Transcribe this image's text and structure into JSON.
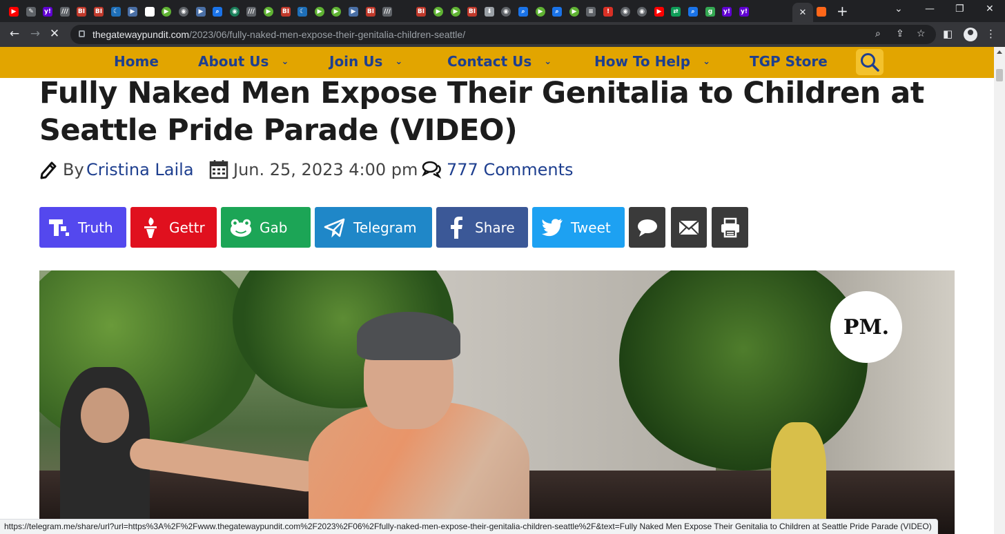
{
  "browser": {
    "tabs": [
      {
        "icon": "youtube-icon",
        "color": "#ff0000",
        "glyph": "▶"
      },
      {
        "icon": "feather-icon",
        "color": "#5f6368",
        "glyph": "✎"
      },
      {
        "icon": "yahoo-icon",
        "color": "#6001d2",
        "glyph": "y!"
      },
      {
        "icon": "ww-icon",
        "color": "#5f6368",
        "glyph": "///"
      },
      {
        "icon": "bi-icon",
        "color": "#c0392b",
        "glyph": "BI"
      },
      {
        "icon": "bi-icon",
        "color": "#c0392b",
        "glyph": "BI"
      },
      {
        "icon": "crescent-icon",
        "color": "#1e6fb8",
        "glyph": "☾"
      },
      {
        "icon": "play-icon",
        "color": "#4a6fa5",
        "glyph": "▶"
      },
      {
        "icon": "grid-icon",
        "color": "#ffffff",
        "glyph": "▦"
      },
      {
        "icon": "rumble-icon",
        "color": "#5fb233",
        "glyph": "▶"
      },
      {
        "icon": "globe-icon",
        "color": "#5f6368",
        "glyph": "◉"
      },
      {
        "icon": "flag-icon",
        "color": "#4a6fa5",
        "glyph": "▶"
      },
      {
        "icon": "search-icon",
        "color": "#1a73e8",
        "glyph": "⌕"
      },
      {
        "icon": "globe-icon",
        "color": "#1a7f5a",
        "glyph": "◉"
      },
      {
        "icon": "ww-icon",
        "color": "#5f6368",
        "glyph": "///"
      },
      {
        "icon": "rumble-icon",
        "color": "#5fb233",
        "glyph": "▶"
      },
      {
        "icon": "bi-icon",
        "color": "#c0392b",
        "glyph": "BI"
      },
      {
        "icon": "crescent-icon",
        "color": "#1e6fb8",
        "glyph": "☾"
      },
      {
        "icon": "rumble-icon",
        "color": "#5fb233",
        "glyph": "▶"
      },
      {
        "icon": "rumble-icon",
        "color": "#5fb233",
        "glyph": "▶"
      },
      {
        "icon": "flag-icon",
        "color": "#4a6fa5",
        "glyph": "▶"
      },
      {
        "icon": "bi-icon",
        "color": "#c0392b",
        "glyph": "BI"
      },
      {
        "icon": "ww-icon",
        "color": "#5f6368",
        "glyph": "///"
      },
      {
        "icon": "blank-icon",
        "color": "#202124",
        "glyph": ""
      },
      {
        "icon": "bi-icon",
        "color": "#c0392b",
        "glyph": "BI"
      },
      {
        "icon": "rumble-icon",
        "color": "#5fb233",
        "glyph": "▶"
      },
      {
        "icon": "rumble-icon",
        "color": "#5fb233",
        "glyph": "▶"
      },
      {
        "icon": "bi-icon",
        "color": "#c0392b",
        "glyph": "BI"
      },
      {
        "icon": "download-icon",
        "color": "#9aa0a6",
        "glyph": "⬇"
      },
      {
        "icon": "globe-icon",
        "color": "#5f6368",
        "glyph": "◉"
      },
      {
        "icon": "search-icon",
        "color": "#1a73e8",
        "glyph": "⌕"
      },
      {
        "icon": "rumble-icon",
        "color": "#5fb233",
        "glyph": "▶"
      },
      {
        "icon": "search-icon",
        "color": "#1a73e8",
        "glyph": "⌕"
      },
      {
        "icon": "rumble-icon",
        "color": "#5fb233",
        "glyph": "▶"
      },
      {
        "icon": "news-icon",
        "color": "#5f6368",
        "glyph": "≡"
      },
      {
        "icon": "alert-icon",
        "color": "#d93025",
        "glyph": "!"
      },
      {
        "icon": "globe-icon",
        "color": "#5f6368",
        "glyph": "◉"
      },
      {
        "icon": "globe-icon",
        "color": "#5f6368",
        "glyph": "◉"
      },
      {
        "icon": "youtube-icon",
        "color": "#ff0000",
        "glyph": "▶"
      },
      {
        "icon": "arrows-icon",
        "color": "#0f9d58",
        "glyph": "⇄"
      },
      {
        "icon": "search-icon",
        "color": "#1a73e8",
        "glyph": "⌕"
      },
      {
        "icon": "gettr-g-icon",
        "color": "#34a853",
        "glyph": "g"
      },
      {
        "icon": "yahoo-icon",
        "color": "#6001d2",
        "glyph": "y!"
      },
      {
        "icon": "yahoo-icon",
        "color": "#6001d2",
        "glyph": "y!"
      }
    ],
    "active_tab_close": "✕",
    "extra_tab": {
      "icon": "substack-icon",
      "color": "#ff6719"
    },
    "new_tab": "+",
    "window_controls": [
      "⌄",
      "—",
      "❐",
      "✕"
    ],
    "url_host": "thegatewaypundit.com",
    "url_path": "/2023/06/fully-naked-men-expose-their-genitalia-children-seattle/",
    "status_url": "https://telegram.me/share/url?url=https%3A%2F%2Fwww.thegatewaypundit.com%2F2023%2F06%2Ffully-naked-men-expose-their-genitalia-children-seattle%2F&text=Fully Naked Men Expose Their Genitalia to Children at Seattle Pride Parade (VIDEO)"
  },
  "site_nav": {
    "bg_color": "#e2a500",
    "link_color": "#1e3f8f",
    "items": [
      {
        "label": "Home",
        "dropdown": false
      },
      {
        "label": "About Us",
        "dropdown": true
      },
      {
        "label": "Join Us",
        "dropdown": true
      },
      {
        "label": "Contact Us",
        "dropdown": true
      },
      {
        "label": "How To Help",
        "dropdown": true
      },
      {
        "label": "TGP Store",
        "dropdown": false
      }
    ],
    "chevron": "⌄"
  },
  "article": {
    "title": "Fully Naked Men Expose Their Genitalia to Children at Seattle Pride Parade (VIDEO)",
    "by_label": "By",
    "author": "Cristina Laila",
    "date": "Jun. 25, 2023 4:00 pm",
    "comments": "777 Comments"
  },
  "share_buttons": [
    {
      "label": "Truth",
      "icon": "truth-social-icon",
      "color": "#5448ee"
    },
    {
      "label": "Gettr",
      "icon": "gettr-torch-icon",
      "color": "#e0101e"
    },
    {
      "label": "Gab",
      "icon": "gab-frog-icon",
      "color": "#1ca556"
    },
    {
      "label": "Telegram",
      "icon": "telegram-plane-icon",
      "color": "#1f87c8"
    },
    {
      "label": "Share",
      "icon": "facebook-icon",
      "color": "#3b5897"
    },
    {
      "label": "Tweet",
      "icon": "twitter-bird-icon",
      "color": "#1da1f2"
    },
    {
      "label": "",
      "icon": "sms-bubble-icon",
      "color": "#3a3a3a"
    },
    {
      "label": "",
      "icon": "email-envelope-icon",
      "color": "#3a3a3a"
    },
    {
      "label": "",
      "icon": "print-icon",
      "color": "#3a3a3a"
    }
  ],
  "hero": {
    "watermark": "PM."
  }
}
